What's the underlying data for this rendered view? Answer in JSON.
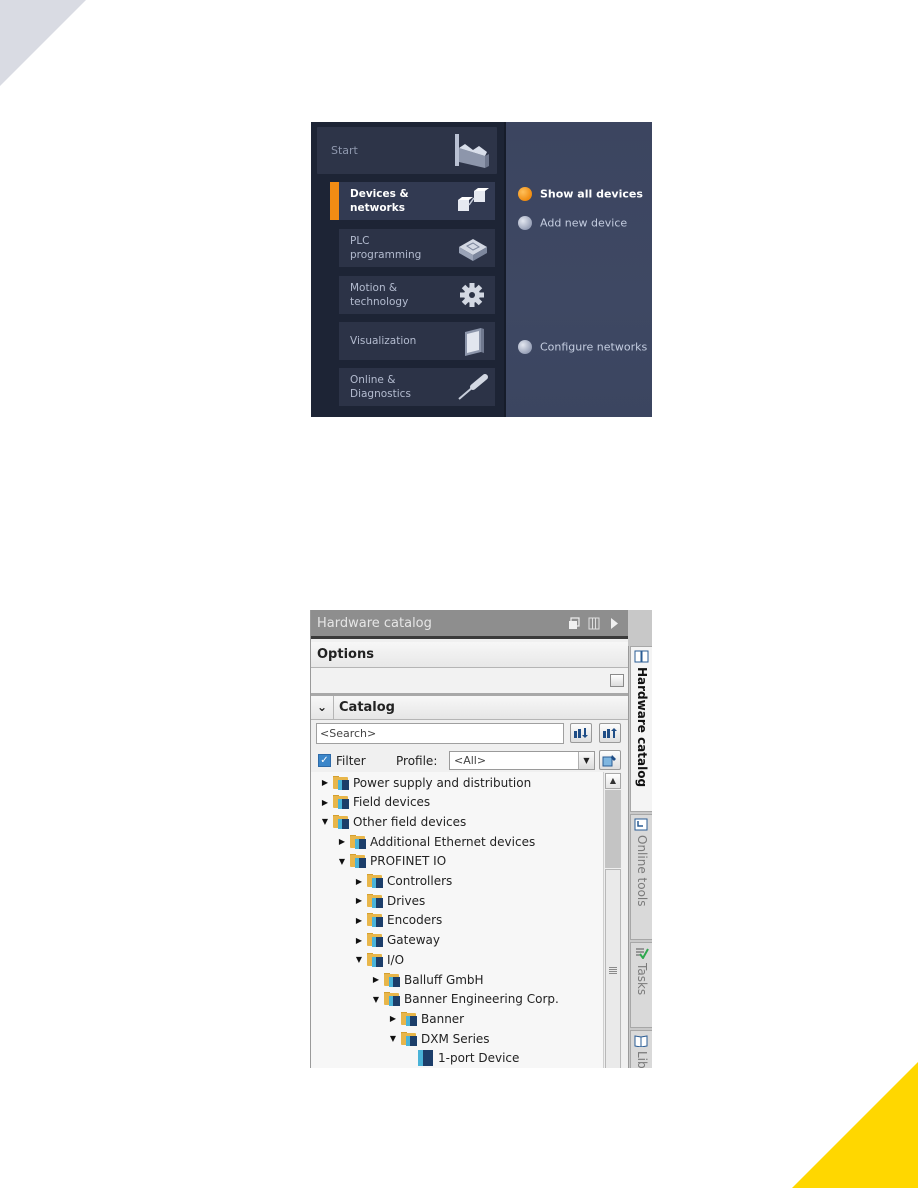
{
  "portal": {
    "start_label": "Start",
    "tiles": [
      {
        "label_line1": "Devices &",
        "label_line2": "networks",
        "active": true,
        "icon": "devices-networks-icon"
      },
      {
        "label_line1": "PLC",
        "label_line2": "programming",
        "active": false,
        "icon": "plc-chip-icon"
      },
      {
        "label_line1": "Motion &",
        "label_line2": "technology",
        "active": false,
        "icon": "gear-icon"
      },
      {
        "label_line1": "Visualization",
        "label_line2": "",
        "active": false,
        "icon": "panel-screen-icon"
      },
      {
        "label_line1": "Online &",
        "label_line2": "Diagnostics",
        "active": false,
        "icon": "screwdriver-icon"
      }
    ],
    "actions": [
      {
        "label": "Show all devices",
        "active": true
      },
      {
        "label": "Add new device",
        "active": false
      },
      {
        "label": "Configure networks",
        "active": false
      }
    ],
    "colors": {
      "accent": "#f28c14",
      "background": "#1d2435",
      "panel": "#3c4560"
    }
  },
  "hardware_catalog": {
    "title": "Hardware catalog",
    "options_label": "Options",
    "catalog_label": "Catalog",
    "search_placeholder": "<Search>",
    "filter_label": "Filter",
    "filter_checked": true,
    "profile_label": "Profile:",
    "profile_value": "<All>",
    "tree": [
      {
        "label": "Power supply and distribution",
        "level": 0,
        "state": "collapsed",
        "type": "folder"
      },
      {
        "label": "Field devices",
        "level": 0,
        "state": "collapsed",
        "type": "folder"
      },
      {
        "label": "Other field devices",
        "level": 0,
        "state": "expanded",
        "type": "folder"
      },
      {
        "label": "Additional Ethernet devices",
        "level": 1,
        "state": "collapsed",
        "type": "folder"
      },
      {
        "label": "PROFINET IO",
        "level": 1,
        "state": "expanded",
        "type": "folder"
      },
      {
        "label": "Controllers",
        "level": 2,
        "state": "collapsed",
        "type": "folder"
      },
      {
        "label": "Drives",
        "level": 2,
        "state": "collapsed",
        "type": "folder"
      },
      {
        "label": "Encoders",
        "level": 2,
        "state": "collapsed",
        "type": "folder"
      },
      {
        "label": "Gateway",
        "level": 2,
        "state": "collapsed",
        "type": "folder"
      },
      {
        "label": "I/O",
        "level": 2,
        "state": "expanded",
        "type": "folder"
      },
      {
        "label": "Balluff GmbH",
        "level": 3,
        "state": "collapsed",
        "type": "folder"
      },
      {
        "label": "Banner Engineering Corp.",
        "level": 3,
        "state": "expanded",
        "type": "folder"
      },
      {
        "label": "Banner",
        "level": 4,
        "state": "collapsed",
        "type": "folder"
      },
      {
        "label": "DXM Series",
        "level": 4,
        "state": "expanded",
        "type": "folder"
      },
      {
        "label": "1-port Device",
        "level": 5,
        "state": "leaf",
        "type": "device"
      }
    ],
    "side_tabs": [
      {
        "label": "Hardware catalog",
        "active": true,
        "icon": "catalog-book-icon"
      },
      {
        "label": "Online tools",
        "active": false,
        "icon": "online-tools-icon"
      },
      {
        "label": "Tasks",
        "active": false,
        "icon": "tasks-check-icon"
      },
      {
        "label": "Lib",
        "active": false,
        "icon": "libraries-book-icon"
      }
    ]
  }
}
